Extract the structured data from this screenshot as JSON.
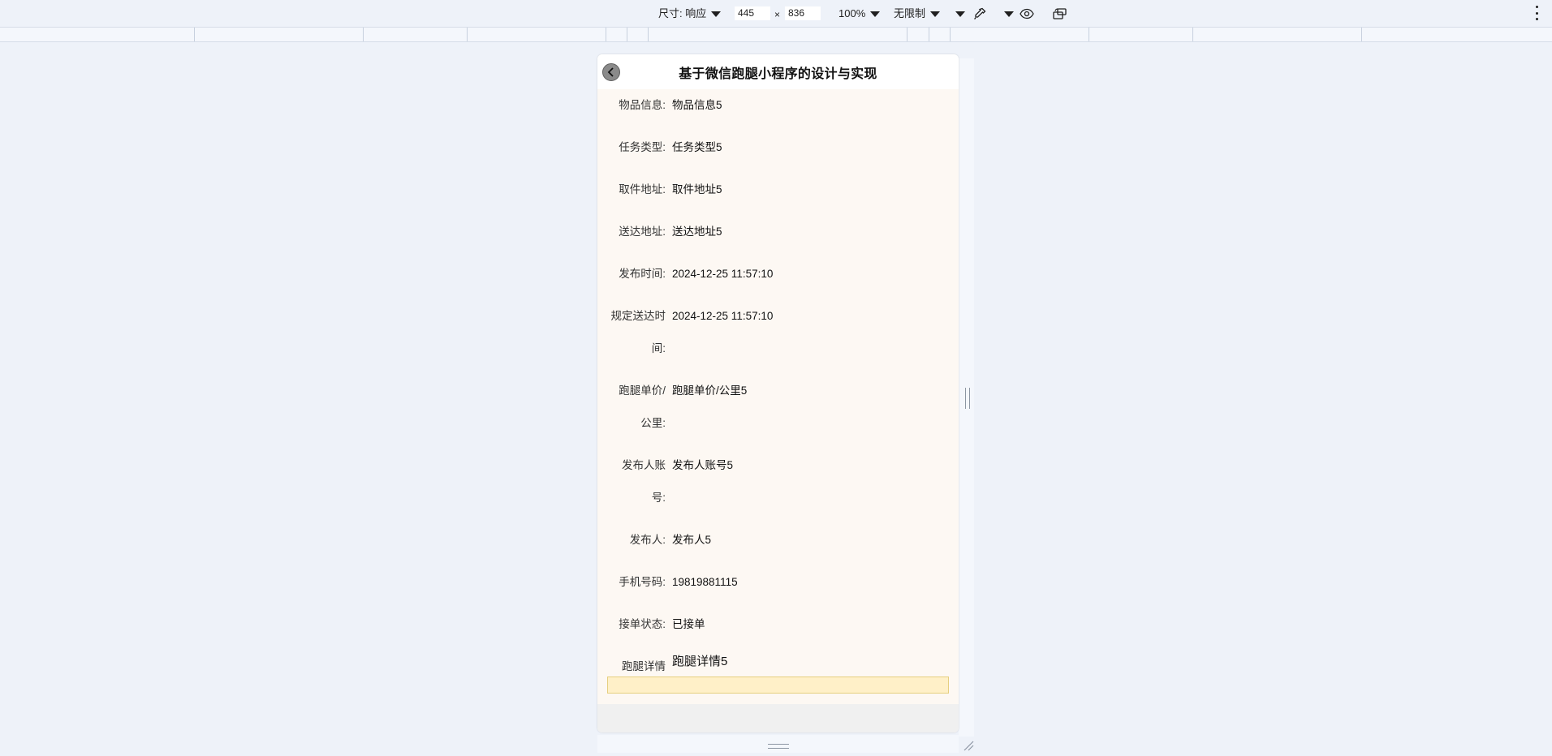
{
  "toolbar": {
    "size_label": "尺寸: 响应",
    "width": "445",
    "times": "×",
    "height": "836",
    "zoom": "100%",
    "throttle": "无限制"
  },
  "page": {
    "title": "基于微信跑腿小程序的设计与实现"
  },
  "fields": [
    {
      "label": "物品信息:",
      "value": "物品信息5"
    },
    {
      "label": "任务类型:",
      "value": "任务类型5"
    },
    {
      "label": "取件地址:",
      "value": "取件地址5"
    },
    {
      "label": "送达地址:",
      "value": "送达地址5"
    },
    {
      "label": "发布时间:",
      "value": "2024-12-25 11:57:10"
    },
    {
      "label_line1": "规定送达时",
      "label_line2": "间:",
      "value": "2024-12-25 11:57:10"
    },
    {
      "label_line1": "跑腿单价/",
      "label_line2": "公里:",
      "value": "跑腿单价/公里5"
    },
    {
      "label_line1": "发布人账",
      "label_line2": "号:",
      "value": "发布人账号5"
    },
    {
      "label": "发布人:",
      "value": "发布人5"
    },
    {
      "label": "手机号码:",
      "value": "19819881115"
    },
    {
      "label": "接单状态:",
      "value": "已接单"
    },
    {
      "label": "跑腿详情",
      "value": "跑腿详情5"
    }
  ],
  "icons": {
    "back": "chevron-left-icon",
    "eyedropper": "eyedropper-icon",
    "vision": "eye-icon",
    "rotate": "rotate-device-icon",
    "more": "more-vertical-icon"
  },
  "colors": {
    "page_bg": "#eef2f9",
    "device_bg": "#fdf8f3",
    "detail_box": "#fff0c8"
  }
}
